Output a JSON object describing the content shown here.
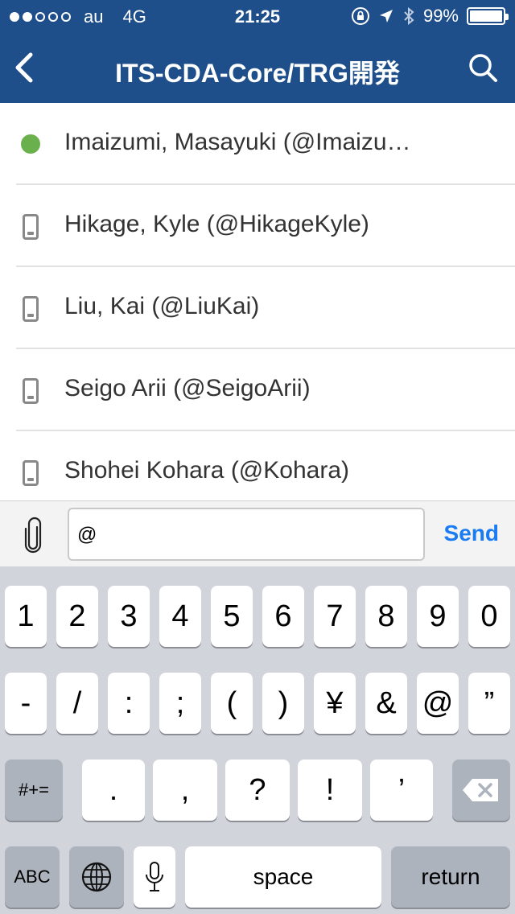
{
  "status_bar": {
    "carrier": "au",
    "network": "4G",
    "time": "21:25",
    "battery": "99%",
    "signal_filled": 2,
    "signal_total": 5,
    "icons": [
      "orientation-lock-icon",
      "location-arrow-icon",
      "bluetooth-icon",
      "battery-icon"
    ]
  },
  "nav": {
    "title": "ITS-CDA-Core/TRG開発",
    "back_icon": "chevron-left-icon",
    "search_icon": "search-icon"
  },
  "members": [
    {
      "name": "Imaizumi, Masayuki (@Imaizu…",
      "status": "online"
    },
    {
      "name": "Hikage, Kyle (@HikageKyle)",
      "status": "mobile"
    },
    {
      "name": "Liu, Kai (@LiuKai)",
      "status": "mobile"
    },
    {
      "name": "Seigo Arii (@SeigoArii)",
      "status": "mobile"
    },
    {
      "name": "Shohei Kohara (@Kohara)",
      "status": "mobile"
    }
  ],
  "composer": {
    "value": "@",
    "send_label": "Send",
    "attach_icon": "paperclip-icon"
  },
  "keyboard": {
    "row1": [
      "1",
      "2",
      "3",
      "4",
      "5",
      "6",
      "7",
      "8",
      "9",
      "0"
    ],
    "row2": [
      "-",
      "/",
      ":",
      ";",
      "(",
      ")",
      "¥",
      "&",
      "@",
      "”"
    ],
    "row3": [
      "#+=",
      ".",
      ",",
      "?",
      "!",
      "’"
    ],
    "row4": [
      "ABC",
      "space",
      "return"
    ],
    "icons": [
      "backspace-icon",
      "globe-icon",
      "microphone-icon"
    ]
  },
  "colors": {
    "header": "#1f4f8a",
    "online": "#6ab04c",
    "send": "#1a7cf2"
  }
}
